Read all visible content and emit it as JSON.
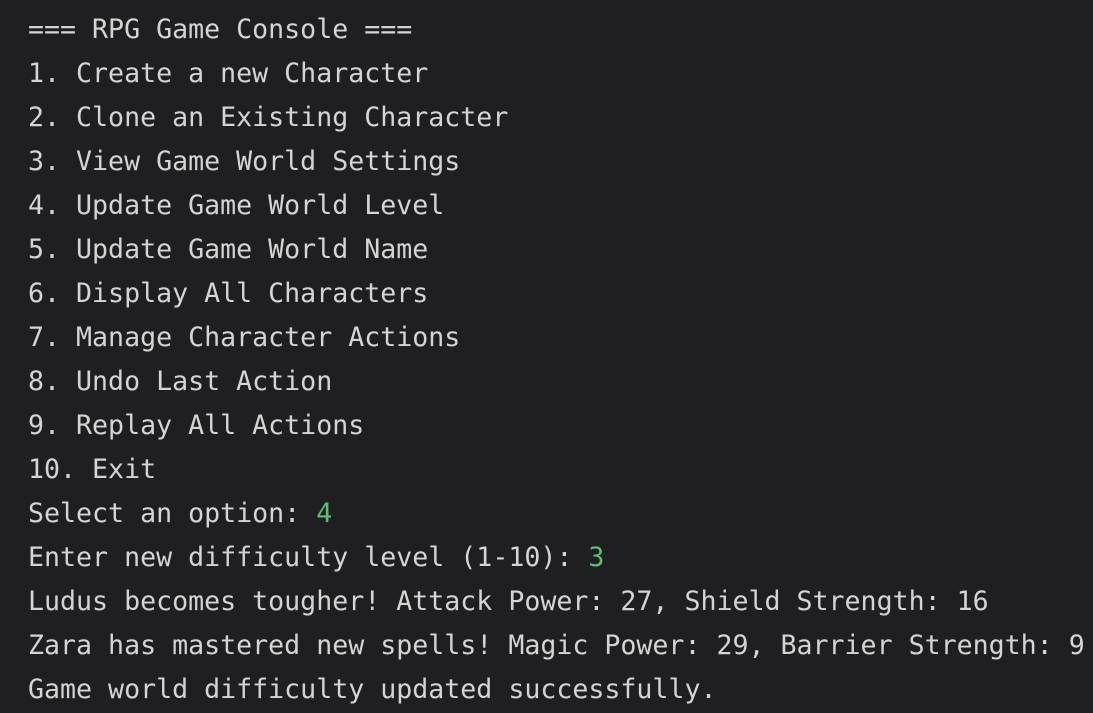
{
  "console": {
    "header": "=== RPG Game Console ===",
    "menu_items": [
      "1. Create a new Character",
      "2. Clone an Existing Character",
      "3. View Game World Settings",
      "4. Update Game World Level",
      "5. Update Game World Name",
      "6. Display All Characters",
      "7. Manage Character Actions",
      "8. Undo Last Action",
      "9. Replay All Actions",
      "10. Exit"
    ],
    "select_prompt": "Select an option: ",
    "select_input": "4",
    "difficulty_prompt": "Enter new difficulty level (1-10): ",
    "difficulty_input": "3",
    "output_lines": [
      "Ludus becomes tougher! Attack Power: 27, Shield Strength: 16",
      "Zara has mastered new spells! Magic Power: 29, Barrier Strength: 9",
      "Game world difficulty updated successfully."
    ],
    "colors": {
      "background": "#1f1f22",
      "text": "#d4d4d4",
      "user_input": "#5ebd72"
    }
  }
}
